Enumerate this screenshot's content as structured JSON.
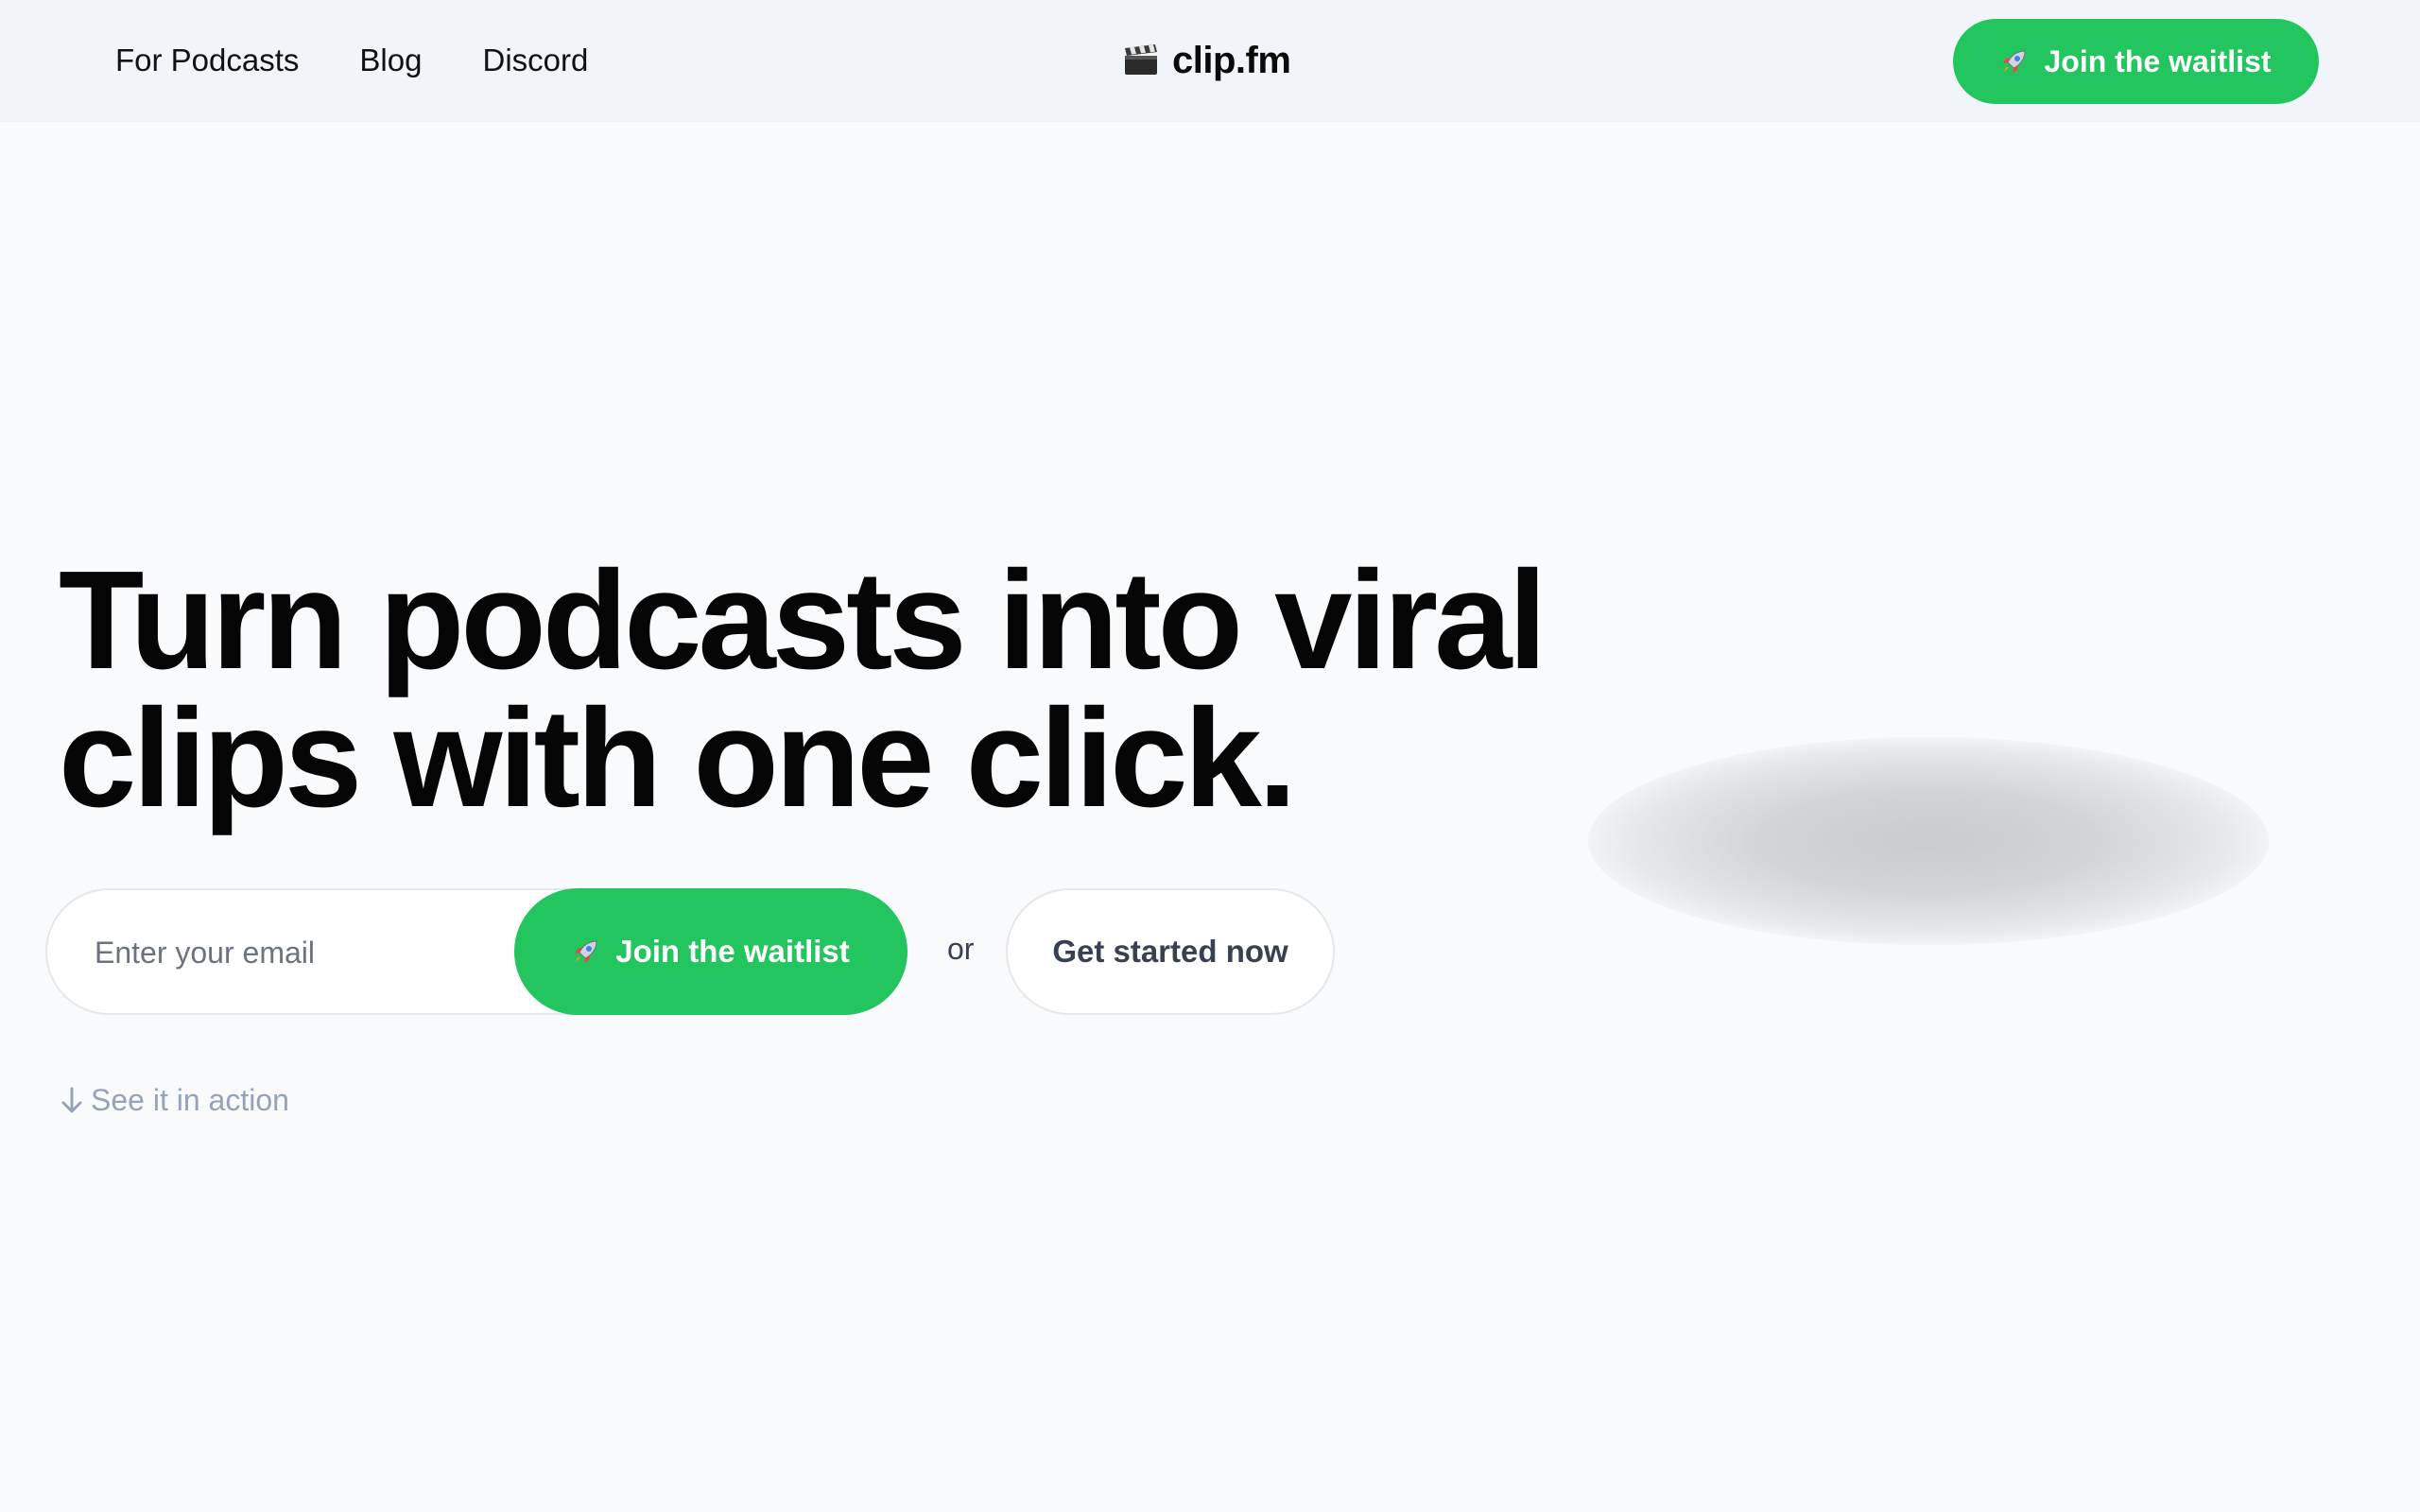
{
  "nav": {
    "links": [
      "For Podcasts",
      "Blog",
      "Discord"
    ]
  },
  "brand": {
    "name": "clip.fm",
    "icon": "clapperboard-icon"
  },
  "header_cta": {
    "label": "Join the waitlist",
    "icon": "rocket-icon"
  },
  "hero": {
    "headline": "Turn podcasts into viral clips with one click.",
    "email_placeholder": "Enter your email",
    "join_label": "Join the waitlist",
    "separator": "or",
    "get_started_label": "Get started now",
    "see_action_label": "See it in action",
    "see_action_icon": "arrow-down-icon"
  },
  "colors": {
    "accent": "#22c55e",
    "header_bg": "#f1f5f9",
    "page_bg": "#f8fafc",
    "muted_text": "#94a3b8"
  }
}
